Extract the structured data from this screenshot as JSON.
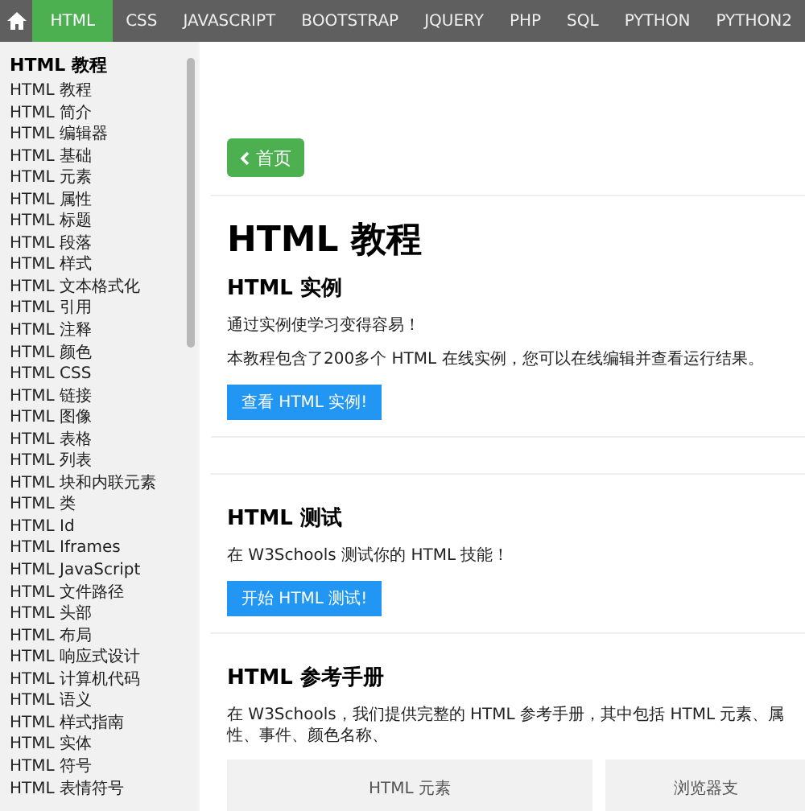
{
  "nav": {
    "tabs": [
      {
        "label": "HTML",
        "selected": true
      },
      {
        "label": "CSS",
        "selected": false
      },
      {
        "label": "JAVASCRIPT",
        "selected": false
      },
      {
        "label": "BOOTSTRAP",
        "selected": false
      },
      {
        "label": "JQUERY",
        "selected": false
      },
      {
        "label": "PHP",
        "selected": false
      },
      {
        "label": "SQL",
        "selected": false
      },
      {
        "label": "PYTHON",
        "selected": false
      },
      {
        "label": "PYTHON2",
        "selected": false
      }
    ]
  },
  "sidebar": {
    "title": "HTML 教程",
    "items": [
      "HTML 教程",
      "HTML 简介",
      "HTML 编辑器",
      "HTML 基础",
      "HTML 元素",
      "HTML 属性",
      "HTML 标题",
      "HTML 段落",
      "HTML 样式",
      "HTML 文本格式化",
      "HTML 引用",
      "HTML 注释",
      "HTML 颜色",
      "HTML CSS",
      "HTML 链接",
      "HTML 图像",
      "HTML 表格",
      "HTML 列表",
      "HTML 块和内联元素",
      "HTML 类",
      "HTML Id",
      "HTML Iframes",
      "HTML JavaScript",
      "HTML 文件路径",
      "HTML 头部",
      "HTML 布局",
      "HTML 响应式设计",
      "HTML 计算机代码",
      "HTML 语义",
      "HTML 样式指南",
      "HTML 实体",
      "HTML 符号",
      "HTML 表情符号"
    ]
  },
  "main": {
    "home_button": "首页",
    "title": "HTML 教程",
    "sections": [
      {
        "heading": "HTML 实例",
        "paragraphs": [
          "通过实例使学习变得容易！",
          "本教程包含了200多个 HTML 在线实例，您可以在线编辑并查看运行结果。"
        ],
        "button": "查看 HTML 实例!"
      },
      {
        "heading": "HTML 测试",
        "paragraphs": [
          "在 W3Schools 测试你的 HTML 技能！"
        ],
        "button": "开始 HTML 测试!"
      },
      {
        "heading": "HTML 参考手册",
        "paragraphs": [
          "在 W3Schools，我们提供完整的 HTML 参考手册，其中包括 HTML 元素、属性、事件、颜色名称、"
        ],
        "cards": [
          "HTML 元素",
          "浏览器支"
        ]
      }
    ]
  }
}
